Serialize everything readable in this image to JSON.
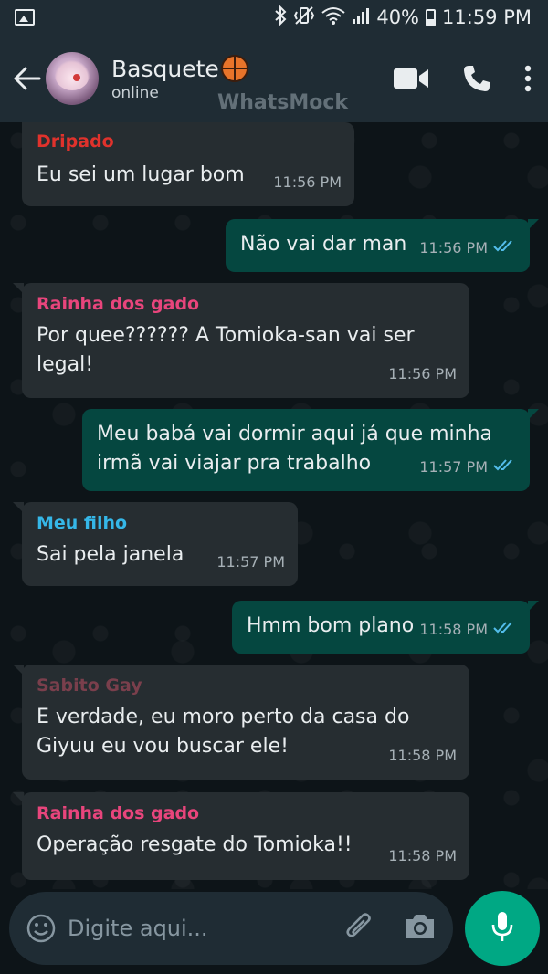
{
  "status_bar": {
    "battery": "40%",
    "time": "11:59 PM",
    "icons": [
      "gallery-icon",
      "bluetooth-icon",
      "vibrate-icon",
      "wifi-icon",
      "signal-icon",
      "battery-icon"
    ]
  },
  "header": {
    "title": "Basquete",
    "title_emoji": "basketball-icon",
    "status": "online",
    "watermark": "WhatsMock",
    "actions": [
      "video-call-icon",
      "voice-call-icon",
      "more-options-icon"
    ]
  },
  "messages": [
    {
      "direction": "in",
      "sender": "Dripado",
      "sender_color": "#e0322c",
      "text": "Eu sei um lugar bom",
      "time": "11:56 PM"
    },
    {
      "direction": "out",
      "text": "Não vai dar man",
      "time": "11:56 PM",
      "read": true
    },
    {
      "direction": "in",
      "sender": "Rainha dos gado",
      "sender_color": "#e8457c",
      "text_lines": [
        "Por quee?????? A Tomioka-san vai ser",
        "legal!"
      ],
      "time": "11:56 PM"
    },
    {
      "direction": "out",
      "text_lines": [
        "Meu babá vai dormir aqui já que minha",
        "irmã vai viajar pra trabalho"
      ],
      "time": "11:57 PM",
      "read": true
    },
    {
      "direction": "in",
      "sender": "Meu filho",
      "sender_color": "#35b7e8",
      "text": "Sai pela janela",
      "time": "11:57 PM"
    },
    {
      "direction": "out",
      "text": "Hmm bom plano",
      "time": "11:58 PM",
      "read": true
    },
    {
      "direction": "in",
      "sender": "Sabito Gay",
      "sender_color": "#7a3f4c",
      "text_lines": [
        "E verdade, eu moro perto da casa do",
        "Giyuu eu vou buscar ele!"
      ],
      "time": "11:58 PM"
    },
    {
      "direction": "in",
      "sender": "Rainha dos gado",
      "sender_color": "#e8457c",
      "text": "Operação resgate do Tomioka!!",
      "time": "11:58 PM"
    }
  ],
  "input": {
    "placeholder": "Digite aqui..."
  },
  "colors": {
    "bubble_in": "#262d31",
    "bubble_out": "#054740",
    "read_tick": "#53bdeb",
    "mic_button": "#00a884"
  }
}
